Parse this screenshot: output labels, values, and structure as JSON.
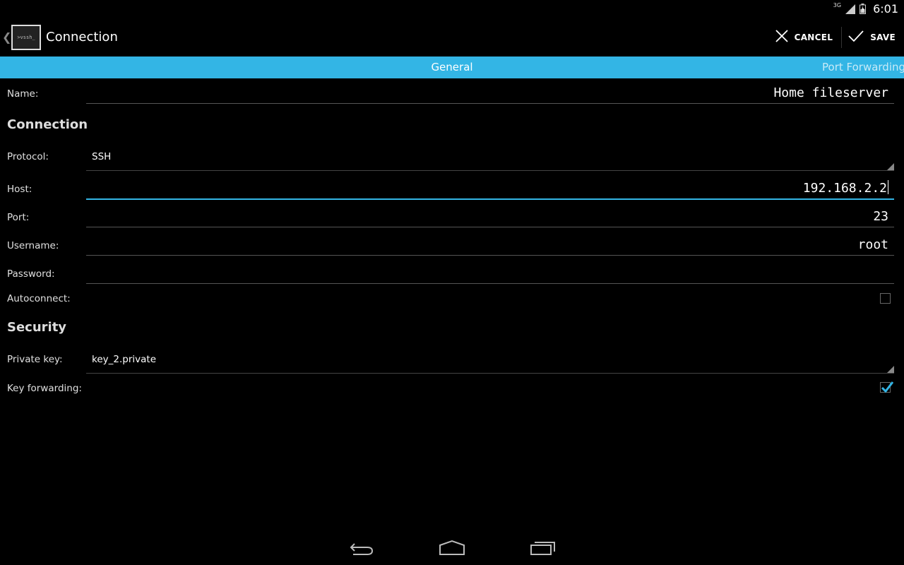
{
  "status_bar": {
    "network": "3G",
    "time": "6:01"
  },
  "action_bar": {
    "logo_text": ">vssh_",
    "title": "Connection",
    "cancel_label": "CANCEL",
    "save_label": "SAVE"
  },
  "tabs": [
    {
      "label": "General",
      "selected": true
    },
    {
      "label": "Port Forwarding",
      "selected": false
    }
  ],
  "form": {
    "name": {
      "label": "Name:",
      "value": "Home fileserver"
    },
    "section_connection": "Connection",
    "protocol": {
      "label": "Protocol:",
      "value": "SSH"
    },
    "host": {
      "label": "Host:",
      "value": "192.168.2.2"
    },
    "port": {
      "label": "Port:",
      "value": "23"
    },
    "username": {
      "label": "Username:",
      "value": "root"
    },
    "password": {
      "label": "Password:",
      "value": ""
    },
    "autoconnect": {
      "label": "Autoconnect:",
      "checked": false
    },
    "section_security": "Security",
    "private_key": {
      "label": "Private key:",
      "value": "key_2.private"
    },
    "key_forwarding": {
      "label": "Key forwarding:",
      "checked": true
    }
  },
  "colors": {
    "accent": "#33b5e5",
    "background": "#000000"
  },
  "nav_bar": {
    "back": "back-icon",
    "home": "home-icon",
    "recents": "recents-icon"
  }
}
